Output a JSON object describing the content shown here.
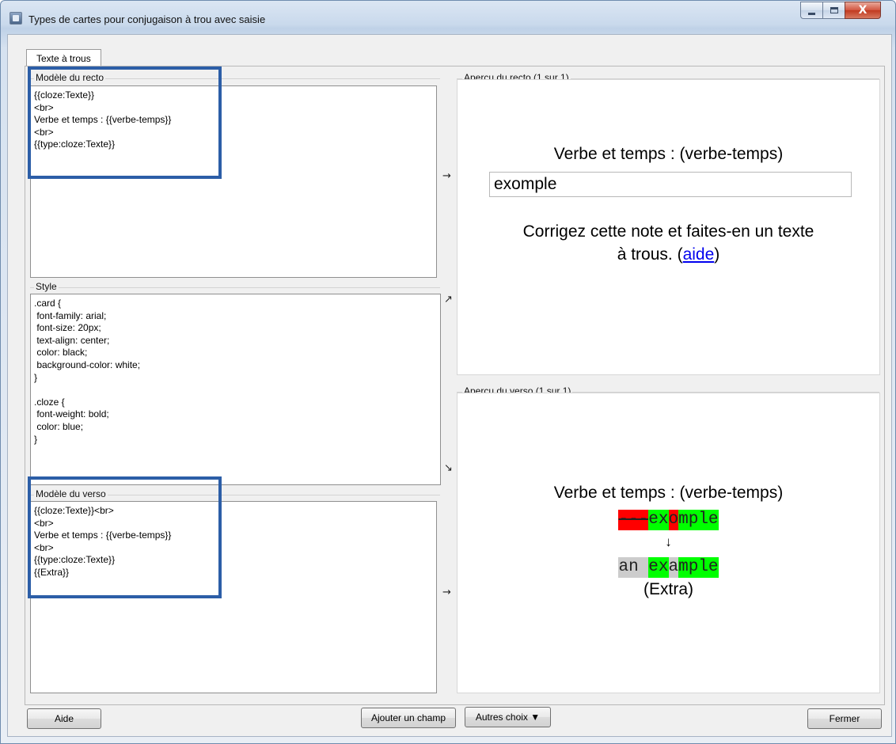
{
  "window": {
    "title": "Types de cartes pour conjugaison à trou avec saisie",
    "close_glyph": "X"
  },
  "tab": {
    "label": "Texte à trous"
  },
  "front_template": {
    "label": "Modèle du recto",
    "lines": [
      "{{cloze:Texte}}",
      "<br>",
      "Verbe et temps : {{verbe-temps}}",
      "<br>",
      "{{type:cloze:Texte}}"
    ]
  },
  "style": {
    "label": "Style",
    "lines": [
      ".card {",
      " font-family: arial;",
      " font-size: 20px;",
      " text-align: center;",
      " color: black;",
      " background-color: white;",
      "}",
      "",
      ".cloze {",
      " font-weight: bold;",
      " color: blue;",
      "}"
    ]
  },
  "back_template": {
    "label": "Modèle du verso",
    "lines": [
      "{{cloze:Texte}}<br>",
      "<br>",
      "Verbe et temps : {{verbe-temps}}",
      "<br>",
      "{{type:cloze:Texte}}",
      "{{Extra}}"
    ]
  },
  "arrows": {
    "front": "→",
    "style_up": "↗",
    "style_down": "↘",
    "back": "→"
  },
  "front_preview": {
    "label": "Aperçu du recto (1 sur 1)",
    "line1": "Verbe et temps : (verbe-temps)",
    "typed": "exomple",
    "msg_line1": "Corrigez cette note et faites-en un texte",
    "msg_line2_prefix": "à trous. (",
    "msg_link": "aide",
    "msg_line2_suffix": ")"
  },
  "back_preview": {
    "label": "Aperçu du verso (1 sur 1)",
    "line1": "Verbe et temps : (verbe-temps)",
    "typed_segments": [
      {
        "text": "---",
        "kind": "bad"
      },
      {
        "text": "ex",
        "kind": "good"
      },
      {
        "text": "o",
        "kind": "bad"
      },
      {
        "text": "mple",
        "kind": "good"
      }
    ],
    "down_arrow": "↓",
    "expected_segments": [
      {
        "text": "an ",
        "kind": "missed"
      },
      {
        "text": "ex",
        "kind": "good"
      },
      {
        "text": "a",
        "kind": "missed"
      },
      {
        "text": "mple",
        "kind": "good"
      }
    ],
    "extra": "(Extra)"
  },
  "buttons": {
    "help": "Aide",
    "add_field": "Ajouter un champ",
    "more": "Autres choix ▼",
    "close": "Fermer"
  },
  "colors": {
    "highlight": "#2c5ea7",
    "diff_bad": "#ff0000",
    "diff_good": "#00ff00",
    "diff_missed": "#cccccc"
  }
}
